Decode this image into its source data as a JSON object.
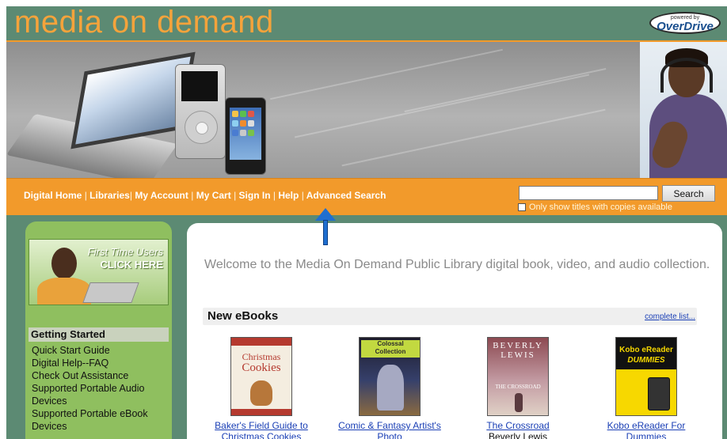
{
  "header": {
    "site_title": "media on demand",
    "overdrive_pre": "powered by",
    "overdrive_name": "OverDrive"
  },
  "nav": {
    "items": [
      "Digital Home",
      "Libraries",
      "My Account",
      "My Cart",
      "Sign In",
      "Help",
      "Advanced Search"
    ],
    "separator": "|"
  },
  "search": {
    "value": "",
    "button_label": "Search",
    "only_available_label": "Only show titles with copies available",
    "only_available_checked": false
  },
  "sidebar": {
    "promo_line1": "First Time Users",
    "promo_line2": "CLICK HERE",
    "getting_started_heading": "Getting Started",
    "links": [
      "Quick Start Guide",
      "Digital Help--FAQ",
      "Check Out Assistance",
      "Supported Portable Audio Devices",
      "Supported Portable eBook Devices"
    ]
  },
  "main": {
    "welcome": "Welcome to the Media On Demand Public Library digital book, video, and audio collection.",
    "new_ebooks_heading": "New eBooks",
    "complete_list_label": "complete list...",
    "books": [
      {
        "title": "Baker's Field Guide to Christmas Cookies",
        "author": "",
        "cover_text": [
          "Christmas",
          "Cookies"
        ]
      },
      {
        "title": "Comic & Fantasy Artist's Photo",
        "author": "",
        "cover_text": [
          "Colossal Collection"
        ]
      },
      {
        "title": "The Crossroad",
        "author": "Beverly Lewis",
        "cover_text": [
          "BEVERLY LEWIS",
          "THE CROSSROAD"
        ]
      },
      {
        "title": "Kobo eReader For Dummies",
        "author": "",
        "cover_text": [
          "Kobo eReader",
          "DUMMIES"
        ]
      }
    ]
  },
  "colors": {
    "title_orange": "#f5a33b",
    "nav_orange": "#f29a2b",
    "frame_green": "#5c8a73",
    "sidebar_green": "#8fbf5f",
    "link_blue": "#1a3fb5",
    "arrow_blue": "#1f6fd0"
  },
  "annotation": {
    "arrow_icon": "up-arrow-icon",
    "points_to": "Sign In"
  }
}
